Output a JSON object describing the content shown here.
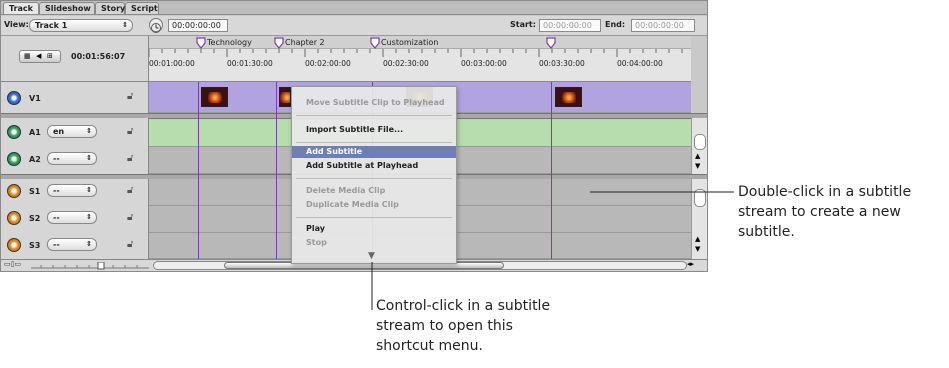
{
  "tabs": [
    "Track",
    "Slideshow",
    "Story",
    "Script"
  ],
  "toolbar": {
    "view_label": "View:",
    "view_value": "Track 1",
    "timecode": "00:00:00:00",
    "start_label": "Start:",
    "start_value": "00:00:00:00",
    "end_label": "End:",
    "end_value": "00:00:00:00"
  },
  "ruler": {
    "duration": "00:01:56:07",
    "times": [
      "00:01:00:00",
      "00:01:30:00",
      "00:02:00:00",
      "00:02:30:00",
      "00:03:00:00",
      "00:03:30:00",
      "00:04:00:00"
    ],
    "markers": [
      "Technology",
      "Chapter 2",
      "Customization"
    ]
  },
  "tracks": [
    {
      "id": "v1",
      "label": "V1",
      "lang": ""
    },
    {
      "id": "a1",
      "label": "A1",
      "lang": "en"
    },
    {
      "id": "a2",
      "label": "A2",
      "lang": "--"
    },
    {
      "id": "s1",
      "label": "S1",
      "lang": "--"
    },
    {
      "id": "s2",
      "label": "S2",
      "lang": "--"
    },
    {
      "id": "s3",
      "label": "S3",
      "lang": "--"
    }
  ],
  "context_menu": {
    "items": [
      "Move Subtitle Clip to Playhead",
      "Import Subtitle File...",
      "Add Subtitle",
      "Add Subtitle at Playhead",
      "Delete Media Clip",
      "Duplicate Media Clip",
      "Play",
      "Stop"
    ]
  },
  "captions": {
    "right": "Double-click in a subtitle stream to create a new subtitle.",
    "right_lines": [
      "Double-click in a subtitle",
      "stream to create a new",
      "subtitle."
    ],
    "bottom": "Control-click in a subtitle stream to open this shortcut menu.",
    "bottom_lines": [
      "Control-click in a subtitle",
      "stream to open this",
      "shortcut menu."
    ]
  },
  "colors": {
    "video_lane": "#b0a3e0",
    "audio_lane_active": "#b7dcae",
    "lane_gray": "#b8b8b8",
    "playhead_purple": "#7a3fa8",
    "highlight": "#6e7fb6"
  }
}
